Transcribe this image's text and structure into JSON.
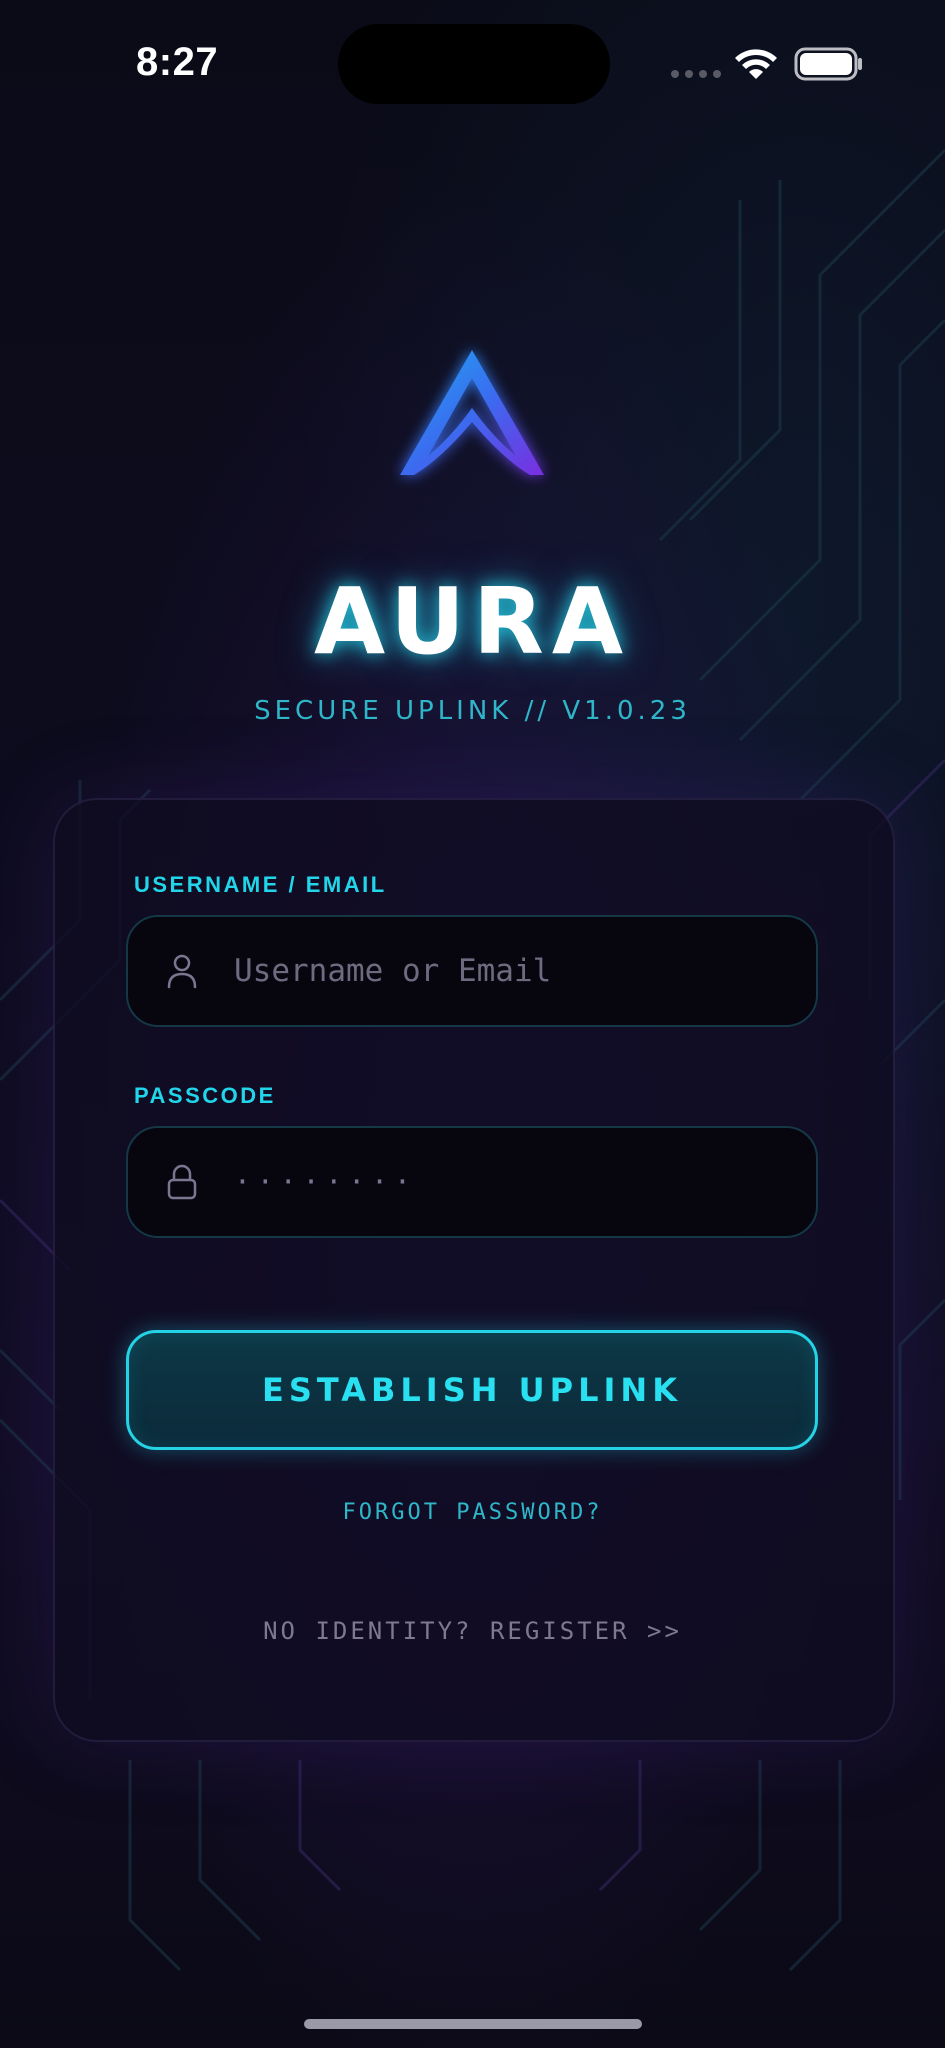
{
  "status_bar": {
    "time": "8:27"
  },
  "brand": {
    "logo_icon": "aura-a-logo-icon",
    "name": "AURA",
    "subtitle": "SECURE UPLINK // V1.0.23"
  },
  "login_form": {
    "username": {
      "label": "USERNAME / EMAIL",
      "placeholder": "Username or Email",
      "icon": "user-icon"
    },
    "passcode": {
      "label": "PASSCODE",
      "masked_value": "········",
      "icon": "lock-icon"
    },
    "submit_label": "ESTABLISH UPLINK",
    "forgot_label": "FORGOT PASSWORD?",
    "register_label": "NO IDENTITY? REGISTER >>"
  },
  "colors": {
    "accent_cyan": "#22d6ea",
    "logo_gradient_start": "#1ea8f0",
    "logo_gradient_end": "#7a2ee0",
    "background": "#0b0b18"
  }
}
